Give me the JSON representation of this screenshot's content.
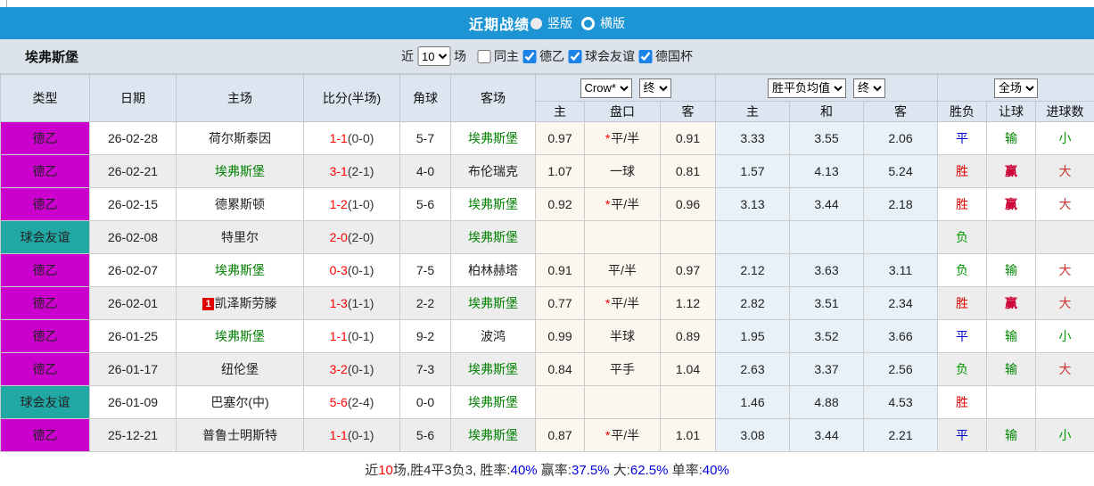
{
  "title_bar": {
    "title": "近期战绩",
    "portrait_label": "竖版",
    "landscape_label": "横版",
    "portrait_selected": true
  },
  "team": {
    "name": "埃弗斯堡"
  },
  "filter": {
    "near_label": "近",
    "match_count": "10",
    "games_label": "场",
    "checkboxes": [
      {
        "label": "同主",
        "checked": false
      },
      {
        "label": "德乙",
        "checked": true
      },
      {
        "label": "球会友谊",
        "checked": true
      },
      {
        "label": "德国杯",
        "checked": true
      }
    ]
  },
  "table": {
    "left_headers": [
      "类型",
      "日期",
      "主场",
      "比分(半场)",
      "角球",
      "客场"
    ],
    "selects": {
      "odds_company": "Crow*",
      "odds_final": "终",
      "avg_type": "胜平负均值",
      "avg_final": "终",
      "scope": "全场"
    },
    "sub_headers": [
      "主",
      "盘口",
      "客",
      "主",
      "和",
      "客",
      "胜负",
      "让球",
      "进球数"
    ],
    "rows": [
      {
        "type": "德乙",
        "category": "league",
        "date": "26-02-28",
        "home": "荷尔斯泰因",
        "home_is_team": false,
        "home_badge": "",
        "score": "1-1",
        "half": "(0-0)",
        "corners": "5-7",
        "away": "埃弗斯堡",
        "away_is_team": true,
        "odds_home": "0.97",
        "handicap_star": true,
        "handicap": "平/半",
        "odds_away": "0.91",
        "avg_home": "3.33",
        "avg_draw": "3.55",
        "avg_away": "2.06",
        "result": "平",
        "handicap_result": "输",
        "goals_result": "小"
      },
      {
        "type": "德乙",
        "category": "league",
        "date": "26-02-21",
        "home": "埃弗斯堡",
        "home_is_team": true,
        "home_badge": "",
        "score": "3-1",
        "half": "(2-1)",
        "corners": "4-0",
        "away": "布伦瑞克",
        "away_is_team": false,
        "odds_home": "1.07",
        "handicap_star": false,
        "handicap": "一球",
        "odds_away": "0.81",
        "avg_home": "1.57",
        "avg_draw": "4.13",
        "avg_away": "5.24",
        "result": "胜",
        "handicap_result": "赢",
        "goals_result": "大"
      },
      {
        "type": "德乙",
        "category": "league",
        "date": "26-02-15",
        "home": "德累斯顿",
        "home_is_team": false,
        "home_badge": "",
        "score": "1-2",
        "half": "(1-0)",
        "corners": "5-6",
        "away": "埃弗斯堡",
        "away_is_team": true,
        "odds_home": "0.92",
        "handicap_star": true,
        "handicap": "平/半",
        "odds_away": "0.96",
        "avg_home": "3.13",
        "avg_draw": "3.44",
        "avg_away": "2.18",
        "result": "胜",
        "handicap_result": "赢",
        "goals_result": "大"
      },
      {
        "type": "球会友谊",
        "category": "friendly",
        "date": "26-02-08",
        "home": "特里尔",
        "home_is_team": false,
        "home_badge": "",
        "score": "2-0",
        "half": "(2-0)",
        "corners": "",
        "away": "埃弗斯堡",
        "away_is_team": true,
        "odds_home": "",
        "handicap_star": false,
        "handicap": "",
        "odds_away": "",
        "avg_home": "",
        "avg_draw": "",
        "avg_away": "",
        "result": "负",
        "handicap_result": "",
        "goals_result": ""
      },
      {
        "type": "德乙",
        "category": "league",
        "date": "26-02-07",
        "home": "埃弗斯堡",
        "home_is_team": true,
        "home_badge": "",
        "score": "0-3",
        "half": "(0-1)",
        "corners": "7-5",
        "away": "柏林赫塔",
        "away_is_team": false,
        "odds_home": "0.91",
        "handicap_star": false,
        "handicap": "平/半",
        "odds_away": "0.97",
        "avg_home": "2.12",
        "avg_draw": "3.63",
        "avg_away": "3.11",
        "result": "负",
        "handicap_result": "输",
        "goals_result": "大"
      },
      {
        "type": "德乙",
        "category": "league",
        "date": "26-02-01",
        "home": "凯泽斯劳滕",
        "home_is_team": false,
        "home_badge": "1",
        "score": "1-3",
        "half": "(1-1)",
        "corners": "2-2",
        "away": "埃弗斯堡",
        "away_is_team": true,
        "odds_home": "0.77",
        "handicap_star": true,
        "handicap": "平/半",
        "odds_away": "1.12",
        "avg_home": "2.82",
        "avg_draw": "3.51",
        "avg_away": "2.34",
        "result": "胜",
        "handicap_result": "赢",
        "goals_result": "大"
      },
      {
        "type": "德乙",
        "category": "league",
        "date": "26-01-25",
        "home": "埃弗斯堡",
        "home_is_team": true,
        "home_badge": "",
        "score": "1-1",
        "half": "(0-1)",
        "corners": "9-2",
        "away": "波鸿",
        "away_is_team": false,
        "odds_home": "0.99",
        "handicap_star": false,
        "handicap": "半球",
        "odds_away": "0.89",
        "avg_home": "1.95",
        "avg_draw": "3.52",
        "avg_away": "3.66",
        "result": "平",
        "handicap_result": "输",
        "goals_result": "小"
      },
      {
        "type": "德乙",
        "category": "league",
        "date": "26-01-17",
        "home": "纽伦堡",
        "home_is_team": false,
        "home_badge": "",
        "score": "3-2",
        "half": "(0-1)",
        "corners": "7-3",
        "away": "埃弗斯堡",
        "away_is_team": true,
        "odds_home": "0.84",
        "handicap_star": false,
        "handicap": "平手",
        "odds_away": "1.04",
        "avg_home": "2.63",
        "avg_draw": "3.37",
        "avg_away": "2.56",
        "result": "负",
        "handicap_result": "输",
        "goals_result": "大"
      },
      {
        "type": "球会友谊",
        "category": "friendly",
        "date": "26-01-09",
        "home": "巴塞尔(中)",
        "home_is_team": false,
        "home_badge": "",
        "score": "5-6",
        "half": "(2-4)",
        "corners": "0-0",
        "away": "埃弗斯堡",
        "away_is_team": true,
        "odds_home": "",
        "handicap_star": false,
        "handicap": "",
        "odds_away": "",
        "avg_home": "1.46",
        "avg_draw": "4.88",
        "avg_away": "4.53",
        "result": "胜",
        "handicap_result": "",
        "goals_result": ""
      },
      {
        "type": "德乙",
        "category": "league",
        "date": "25-12-21",
        "home": "普鲁士明斯特",
        "home_is_team": false,
        "home_badge": "",
        "score": "1-1",
        "half": "(0-1)",
        "corners": "5-6",
        "away": "埃弗斯堡",
        "away_is_team": true,
        "odds_home": "0.87",
        "handicap_star": true,
        "handicap": "平/半",
        "odds_away": "1.01",
        "avg_home": "3.08",
        "avg_draw": "3.44",
        "avg_away": "2.21",
        "result": "平",
        "handicap_result": "输",
        "goals_result": "小"
      }
    ]
  },
  "footer": {
    "parts": [
      {
        "text": "近",
        "color": "default"
      },
      {
        "text": "10",
        "color": "red"
      },
      {
        "text": "场,胜4平3负3, 胜率:",
        "color": "default"
      },
      {
        "text": "40%",
        "color": "blue"
      },
      {
        "text": " 赢率:",
        "color": "default"
      },
      {
        "text": "37.5%",
        "color": "blue"
      },
      {
        "text": " 大:",
        "color": "default"
      },
      {
        "text": "62.5%",
        "color": "blue"
      },
      {
        "text": " 单率:",
        "color": "default"
      },
      {
        "text": "40%",
        "color": "blue"
      }
    ]
  },
  "colors": {
    "accent_blue": "#1d95d4",
    "league_bg": "#cc00cc",
    "friendly_bg": "#21a8a4",
    "team_green": "#008000",
    "score_red": "#ff0000",
    "count_red": "#ff0000",
    "percent_blue": "#0000dd",
    "result_map": {
      "胜": "#dd0000",
      "平": "#0000cc",
      "负": "#009900",
      "赢": "#cc0033",
      "输": "#008800",
      "大": "#cc3333",
      "小": "#009900"
    }
  }
}
